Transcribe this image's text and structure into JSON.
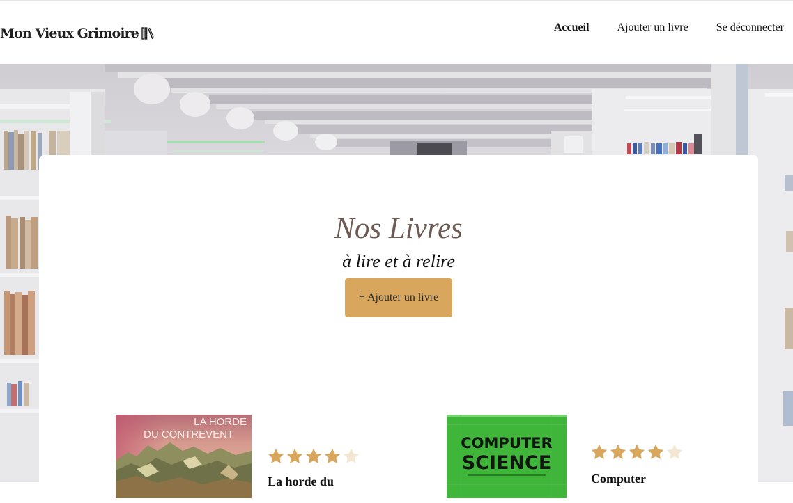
{
  "header": {
    "logo_text": "Mon Vieux Grimoire",
    "logo_icon": "books-icon",
    "nav": [
      {
        "label": "Accueil",
        "active": true
      },
      {
        "label": "Ajouter un livre",
        "active": false
      },
      {
        "label": "Se déconnecter",
        "active": false
      }
    ]
  },
  "main": {
    "title": "Nos Livres",
    "subtitle": "à lire et à relire",
    "add_button": "+ Ajouter un livre"
  },
  "books": [
    {
      "cover_text_line1": "LA HORDE",
      "cover_text_line2": "DU CONTREVENT",
      "rating": 4,
      "rating_max": 5,
      "title": "La horde du"
    },
    {
      "cover_text_line1": "COMPUTER",
      "cover_text_line2": "SCIENCE",
      "rating": 4,
      "rating_max": 5,
      "title": "Computer"
    }
  ],
  "colors": {
    "accent": "#d8a75d",
    "title_color": "#6d5a52",
    "star_filled": "#d8a75d",
    "star_empty": "#f3e7d4"
  }
}
